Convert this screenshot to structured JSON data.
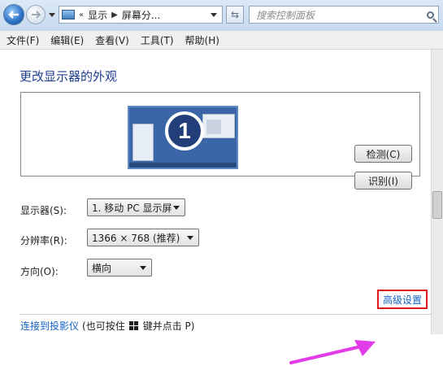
{
  "address_bar": {
    "breadcrumb_prefix": "«",
    "crumbs": [
      "显示",
      "屏幕分..."
    ],
    "search_placeholder": "搜索控制面板"
  },
  "menu": [
    "文件(F)",
    "编辑(E)",
    "查看(V)",
    "工具(T)",
    "帮助(H)"
  ],
  "main": {
    "title": "更改显示器的外观",
    "monitor_number": "1",
    "detect_button": "检测(C)",
    "identify_button": "识别(I)",
    "display_label": "显示器(S):",
    "display_value": "1. 移动 PC 显示屏",
    "resolution_label": "分辨率(R):",
    "resolution_value": "1366 × 768 (推荐)",
    "orientation_label": "方向(O):",
    "orientation_value": "横向",
    "advanced_link": "高级设置",
    "projector_link": "连接到投影仪",
    "projector_hint_before": "(也可按住",
    "projector_hint_after": "键并点击 P)"
  },
  "colors": {
    "highlight_box": "#e01818",
    "annotation_arrow": "#e23be8",
    "link": "#1561c4",
    "title": "#1e3e8f"
  }
}
